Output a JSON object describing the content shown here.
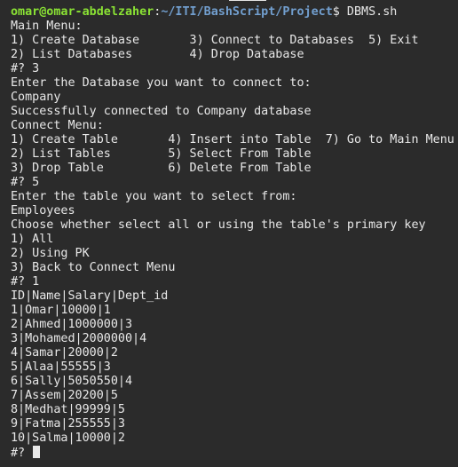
{
  "prompt": {
    "user_host": "omar@omar-abdelzaher",
    "colon": ":",
    "path": "~/ITI/BashScript/Project",
    "dollar": "$ ",
    "command": "DBMS.sh"
  },
  "lines": [
    "Main Menu:",
    "1) Create Database       3) Connect to Databases  5) Exit",
    "2) List Databases        4) Drop Database",
    "#? 3",
    "Enter the Database you want to connect to:",
    "Company",
    "Successfully connected to Company database",
    "Connect Menu:",
    "1) Create Table       4) Insert into Table  7) Go to Main Menu",
    "2) List Tables        5) Select From Table",
    "3) Drop Table         6) Delete From Table",
    "#? 5",
    "Enter the table you want to select from:",
    "Employees",
    "Choose whether select all or using the table's primary key",
    "1) All",
    "2) Using PK",
    "3) Back to Connect Menu",
    "#? 1",
    "ID|Name|Salary|Dept_id",
    "1|Omar|10000|1",
    "2|Ahmed|1000000|3",
    "3|Mohamed|2000000|4",
    "4|Samar|20000|2",
    "5|Alaa|55555|3",
    "6|Sally|5050550|4",
    "7|Assem|20200|5",
    "8|Medhat|99999|5",
    "9|Fatma|255555|3",
    "10|Salma|10000|2"
  ],
  "final_prompt": "#? ",
  "colors": {
    "background": "#2b2b2b",
    "foreground": "#e8e8e8",
    "user": "#8ae234",
    "path": "#729fcf"
  }
}
